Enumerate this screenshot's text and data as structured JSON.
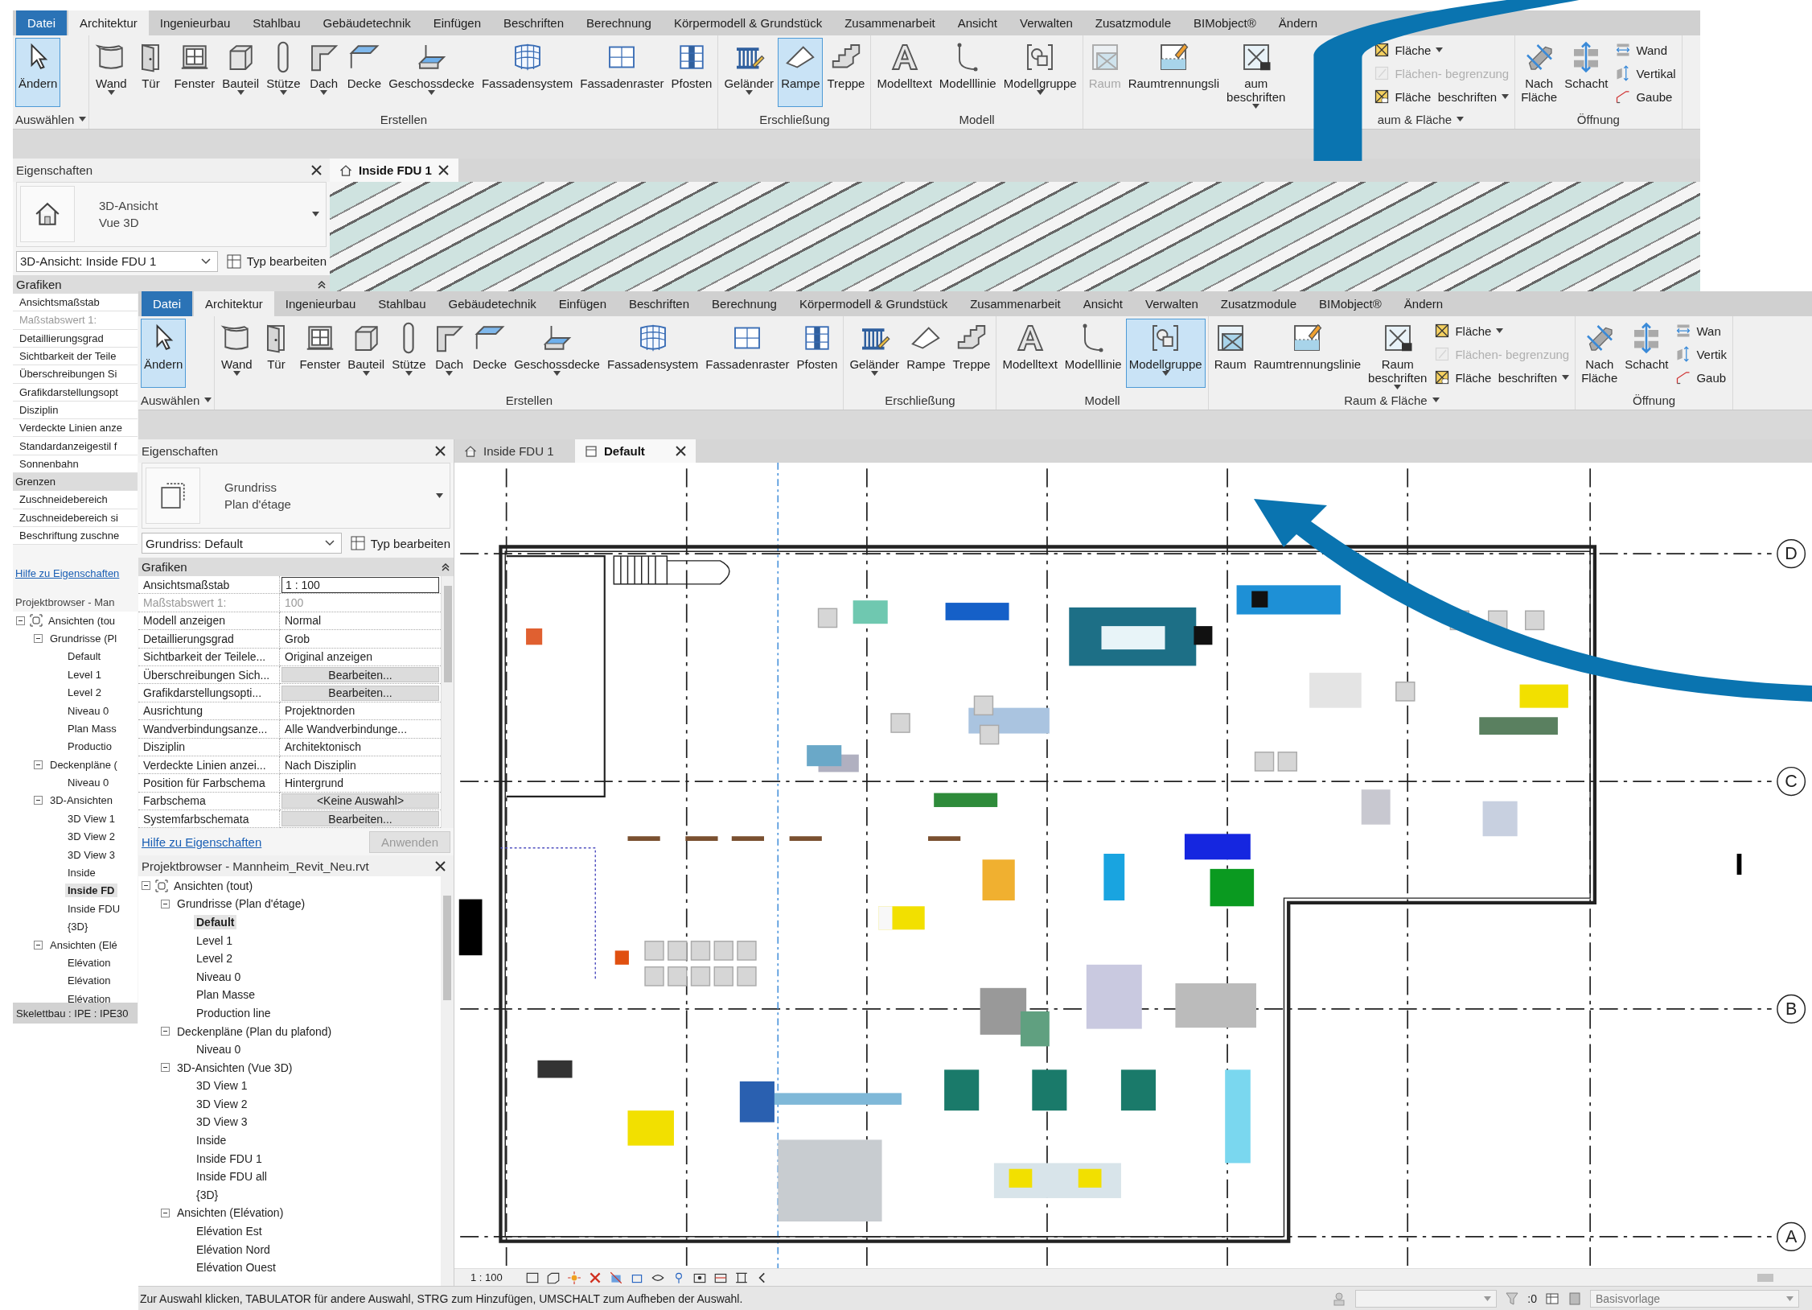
{
  "back_window": {
    "ribbon_tabs": [
      {
        "label": "Datei",
        "kind": "menu",
        "selected": false
      },
      {
        "label": "Architektur",
        "kind": "tab",
        "selected": true
      },
      {
        "label": "Ingenieurbau",
        "kind": "tab",
        "selected": false
      },
      {
        "label": "Stahlbau",
        "kind": "tab",
        "selected": false
      },
      {
        "label": "Gebäudetechnik",
        "kind": "tab",
        "selected": false
      },
      {
        "label": "Einfügen",
        "kind": "tab",
        "selected": false
      },
      {
        "label": "Beschriften",
        "kind": "tab",
        "selected": false
      },
      {
        "label": "Berechnung",
        "kind": "tab",
        "selected": false
      },
      {
        "label": "Körpermodell & Grundstück",
        "kind": "tab",
        "selected": false
      },
      {
        "label": "Zusammenarbeit",
        "kind": "tab",
        "selected": false
      },
      {
        "label": "Ansicht",
        "kind": "tab",
        "selected": false
      },
      {
        "label": "Verwalten",
        "kind": "tab",
        "selected": false
      },
      {
        "label": "Zusatzmodule",
        "kind": "tab",
        "selected": false
      },
      {
        "label": "BIMobject®",
        "kind": "tab",
        "selected": false
      },
      {
        "label": "Ändern",
        "kind": "tab",
        "selected": false
      }
    ],
    "ribbon_groups": [
      {
        "label": "Auswählen",
        "menu": true,
        "tools": [
          {
            "kind": "large",
            "label": "Ändern",
            "active": true,
            "disabled": false,
            "menu": false
          }
        ]
      },
      {
        "label": "Erstellen",
        "menu": false,
        "tools": [
          {
            "kind": "large",
            "label": "Wand",
            "active": false,
            "disabled": false,
            "menu": true
          },
          {
            "kind": "large",
            "label": "Tür",
            "active": false,
            "disabled": false,
            "menu": false
          },
          {
            "kind": "large",
            "label": "Fenster",
            "active": false,
            "disabled": false,
            "menu": false
          },
          {
            "kind": "large",
            "label": "Bauteil",
            "active": false,
            "disabled": false,
            "menu": true
          },
          {
            "kind": "large",
            "label": "Stütze",
            "active": false,
            "disabled": false,
            "menu": true
          },
          {
            "kind": "large",
            "label": "Dach",
            "active": false,
            "disabled": false,
            "menu": true
          },
          {
            "kind": "large",
            "label": "Decke",
            "active": false,
            "disabled": false,
            "menu": false
          },
          {
            "kind": "large",
            "label": "Geschossdecke",
            "active": false,
            "disabled": false,
            "menu": true
          },
          {
            "kind": "large",
            "label": "Fassadensystem",
            "active": false,
            "disabled": false,
            "menu": false
          },
          {
            "kind": "large",
            "label": "Fassadenraster",
            "active": false,
            "disabled": false,
            "menu": false
          },
          {
            "kind": "large",
            "label": "Pfosten",
            "active": false,
            "disabled": false,
            "menu": false
          }
        ]
      },
      {
        "label": "Erschließung",
        "menu": false,
        "tools": [
          {
            "kind": "large",
            "label": "Geländer",
            "active": false,
            "disabled": false,
            "menu": true
          },
          {
            "kind": "large",
            "label": "Rampe",
            "active": true,
            "disabled": false,
            "menu": false
          },
          {
            "kind": "large",
            "label": "Treppe",
            "active": false,
            "disabled": false,
            "menu": false
          }
        ]
      },
      {
        "label": "Modell",
        "menu": false,
        "tools": [
          {
            "kind": "large",
            "label": "Modelltext",
            "active": false,
            "disabled": false,
            "menu": false
          },
          {
            "kind": "large",
            "label": "Modelllinie",
            "active": false,
            "disabled": false,
            "menu": false
          },
          {
            "kind": "large",
            "label": "Modellgruppe",
            "active": false,
            "disabled": false,
            "menu": true
          }
        ]
      },
      {
        "label": "aum & Fläche",
        "menu": true,
        "tools": [
          {
            "kind": "large",
            "label": "Raum",
            "active": false,
            "disabled": true,
            "menu": false
          },
          {
            "kind": "large",
            "label": "Raumtrennungsli",
            "active": false,
            "disabled": false,
            "menu": false
          },
          {
            "kind": "large",
            "label": "aum\nbeschriften",
            "active": false,
            "disabled": false,
            "menu": true
          },
          {
            "kind": "stack",
            "items": [
              {
                "label": "Fläche",
                "disabled": false,
                "menu": true
              },
              {
                "label": "Flächen- begrenzung",
                "disabled": true,
                "menu": false
              },
              {
                "label": "Fläche  beschriften",
                "disabled": false,
                "menu": true
              }
            ]
          }
        ]
      },
      {
        "label": "Öffnung",
        "menu": false,
        "tools": [
          {
            "kind": "large",
            "label": "Nach\nFläche",
            "active": false,
            "disabled": false,
            "menu": false
          },
          {
            "kind": "large",
            "label": "Schacht",
            "active": false,
            "disabled": false,
            "menu": false
          },
          {
            "kind": "stack",
            "items": [
              {
                "label": "Wand",
                "disabled": false,
                "menu": false
              },
              {
                "label": "Vertikal",
                "disabled": false,
                "menu": false
              },
              {
                "label": "Gaube",
                "disabled": false,
                "menu": false
              }
            ]
          }
        ]
      }
    ],
    "properties": {
      "title": "Eigenschaften",
      "type_name": "3D-Ansicht",
      "type_sub": "Vue 3D",
      "selector": "3D-Ansicht: Inside FDU 1",
      "edit_type": "Typ bearbeiten",
      "section": "Grafiken",
      "rows": [
        {
          "label": "Ansichtsmaßstab",
          "kind": "row",
          "disabled": false
        },
        {
          "label": "Maßstabswert 1:",
          "kind": "row",
          "disabled": true
        },
        {
          "label": "Detaillierungsgrad",
          "kind": "row",
          "disabled": false
        },
        {
          "label": "Sichtbarkeit der Teile",
          "kind": "row",
          "disabled": false
        },
        {
          "label": "Überschreibungen Si",
          "kind": "row",
          "disabled": false
        },
        {
          "label": "Grafikdarstellungsopt",
          "kind": "row",
          "disabled": false
        },
        {
          "label": "Disziplin",
          "kind": "row",
          "disabled": false
        },
        {
          "label": "Verdeckte Linien anze",
          "kind": "row",
          "disabled": false
        },
        {
          "label": "Standardanzeigestil f",
          "kind": "row",
          "disabled": false
        },
        {
          "label": "Sonnenbahn",
          "kind": "row",
          "disabled": false
        },
        {
          "label": "Grenzen",
          "kind": "section",
          "disabled": false
        },
        {
          "label": "Zuschneidebereich",
          "kind": "row",
          "disabled": false
        },
        {
          "label": "Zuschneidebereich si",
          "kind": "row",
          "disabled": false
        },
        {
          "label": "Beschriftung zuschne",
          "kind": "row",
          "disabled": false
        }
      ],
      "help_link": "Hilfe zu Eigenschaften"
    },
    "browser": {
      "title": "Projektbrowser - Man",
      "tree": [
        {
          "label": "Ansichten (tou",
          "expanded": true,
          "selected": false,
          "children": [
            {
              "label": "Grundrisse (Pl",
              "expanded": true,
              "selected": false,
              "children": [
                {
                  "label": "Default",
                  "selected": false
                },
                {
                  "label": "Level 1",
                  "selected": false
                },
                {
                  "label": "Level 2",
                  "selected": false
                },
                {
                  "label": "Niveau 0",
                  "selected": false
                },
                {
                  "label": "Plan Mass",
                  "selected": false
                },
                {
                  "label": "Productio",
                  "selected": false
                }
              ]
            },
            {
              "label": "Deckenpläne (",
              "expanded": true,
              "selected": false,
              "children": [
                {
                  "label": "Niveau 0",
                  "selected": false
                }
              ]
            },
            {
              "label": "3D-Ansichten",
              "expanded": true,
              "selected": false,
              "children": [
                {
                  "label": "3D View 1",
                  "selected": false
                },
                {
                  "label": "3D View 2",
                  "selected": false
                },
                {
                  "label": "3D View 3",
                  "selected": false
                },
                {
                  "label": "Inside",
                  "selected": false
                },
                {
                  "label": "Inside FD",
                  "selected": true
                },
                {
                  "label": "Inside FDU",
                  "selected": false
                },
                {
                  "label": "{3D}",
                  "selected": false
                }
              ]
            },
            {
              "label": "Ansichten (Elé",
              "expanded": true,
              "selected": false,
              "children": [
                {
                  "label": "Elévation",
                  "selected": false
                },
                {
                  "label": "Elévation",
                  "selected": false
                },
                {
                  "label": "Elévation",
                  "selected": false
                }
              ]
            }
          ]
        }
      ]
    },
    "status": "Skelettbau : IPE : IPE30",
    "view_tab": "Inside FDU 1"
  },
  "front_window": {
    "ribbon_tabs": [
      {
        "label": "Datei",
        "kind": "menu",
        "selected": false
      },
      {
        "label": "Architektur",
        "kind": "tab",
        "selected": true
      },
      {
        "label": "Ingenieurbau",
        "kind": "tab",
        "selected": false
      },
      {
        "label": "Stahlbau",
        "kind": "tab",
        "selected": false
      },
      {
        "label": "Gebäudetechnik",
        "kind": "tab",
        "selected": false
      },
      {
        "label": "Einfügen",
        "kind": "tab",
        "selected": false
      },
      {
        "label": "Beschriften",
        "kind": "tab",
        "selected": false
      },
      {
        "label": "Berechnung",
        "kind": "tab",
        "selected": false
      },
      {
        "label": "Körpermodell & Grundstück",
        "kind": "tab",
        "selected": false
      },
      {
        "label": "Zusammenarbeit",
        "kind": "tab",
        "selected": false
      },
      {
        "label": "Ansicht",
        "kind": "tab",
        "selected": false
      },
      {
        "label": "Verwalten",
        "kind": "tab",
        "selected": false
      },
      {
        "label": "Zusatzmodule",
        "kind": "tab",
        "selected": false
      },
      {
        "label": "BIMobject®",
        "kind": "tab",
        "selected": false
      },
      {
        "label": "Ändern",
        "kind": "tab",
        "selected": false
      }
    ],
    "ribbon_groups": [
      {
        "label": "Auswählen",
        "menu": true,
        "tools": [
          {
            "kind": "large",
            "label": "Ändern",
            "active": true,
            "disabled": false,
            "menu": false
          }
        ]
      },
      {
        "label": "Erstellen",
        "menu": false,
        "tools": [
          {
            "kind": "large",
            "label": "Wand",
            "active": false,
            "disabled": false,
            "menu": true
          },
          {
            "kind": "large",
            "label": "Tür",
            "active": false,
            "disabled": false,
            "menu": false
          },
          {
            "kind": "large",
            "label": "Fenster",
            "active": false,
            "disabled": false,
            "menu": false
          },
          {
            "kind": "large",
            "label": "Bauteil",
            "active": false,
            "disabled": false,
            "menu": true
          },
          {
            "kind": "large",
            "label": "Stütze",
            "active": false,
            "disabled": false,
            "menu": true
          },
          {
            "kind": "large",
            "label": "Dach",
            "active": false,
            "disabled": false,
            "menu": true
          },
          {
            "kind": "large",
            "label": "Decke",
            "active": false,
            "disabled": false,
            "menu": false
          },
          {
            "kind": "large",
            "label": "Geschossdecke",
            "active": false,
            "disabled": false,
            "menu": true
          },
          {
            "kind": "large",
            "label": "Fassadensystem",
            "active": false,
            "disabled": false,
            "menu": false
          },
          {
            "kind": "large",
            "label": "Fassadenraster",
            "active": false,
            "disabled": false,
            "menu": false
          },
          {
            "kind": "large",
            "label": "Pfosten",
            "active": false,
            "disabled": false,
            "menu": false
          }
        ]
      },
      {
        "label": "Erschließung",
        "menu": false,
        "tools": [
          {
            "kind": "large",
            "label": "Geländer",
            "active": false,
            "disabled": false,
            "menu": true
          },
          {
            "kind": "large",
            "label": "Rampe",
            "active": false,
            "disabled": false,
            "menu": false
          },
          {
            "kind": "large",
            "label": "Treppe",
            "active": false,
            "disabled": false,
            "menu": false
          }
        ]
      },
      {
        "label": "Modell",
        "menu": false,
        "tools": [
          {
            "kind": "large",
            "label": "Modelltext",
            "active": false,
            "disabled": false,
            "menu": false
          },
          {
            "kind": "large",
            "label": "Modelllinie",
            "active": false,
            "disabled": false,
            "menu": false
          },
          {
            "kind": "large",
            "label": "Modellgruppe",
            "active": true,
            "disabled": false,
            "menu": true
          }
        ]
      },
      {
        "label": "Raum & Fläche",
        "menu": true,
        "tools": [
          {
            "kind": "large",
            "label": "Raum",
            "active": false,
            "disabled": false,
            "menu": false
          },
          {
            "kind": "large",
            "label": "Raumtrennungslinie",
            "active": false,
            "disabled": false,
            "menu": false
          },
          {
            "kind": "large",
            "label": "Raum\nbeschriften",
            "active": false,
            "disabled": false,
            "menu": true
          },
          {
            "kind": "stack",
            "items": [
              {
                "label": "Fläche",
                "disabled": false,
                "menu": true
              },
              {
                "label": "Flächen- begrenzung",
                "disabled": true,
                "menu": false
              },
              {
                "label": "Fläche  beschriften",
                "disabled": false,
                "menu": true
              }
            ]
          }
        ]
      },
      {
        "label": "Öffnung",
        "menu": false,
        "tools": [
          {
            "kind": "large",
            "label": "Nach\nFläche",
            "active": false,
            "disabled": false,
            "menu": false
          },
          {
            "kind": "large",
            "label": "Schacht",
            "active": false,
            "disabled": false,
            "menu": false
          },
          {
            "kind": "stack",
            "items": [
              {
                "label": "Wan",
                "disabled": false,
                "menu": false
              },
              {
                "label": "Vertik",
                "disabled": false,
                "menu": false
              },
              {
                "label": "Gaub",
                "disabled": false,
                "menu": false
              }
            ]
          }
        ]
      }
    ],
    "properties": {
      "title": "Eigenschaften",
      "type_name": "Grundriss",
      "type_sub": "Plan d'étage",
      "selector": "Grundriss: Default",
      "edit_type": "Typ bearbeiten",
      "section": "Grafiken",
      "rows": [
        {
          "label": "Ansichtsmaßstab",
          "value": "1 : 100",
          "kind": "input"
        },
        {
          "label": "Maßstabswert 1:",
          "value": "100",
          "kind": "readonly"
        },
        {
          "label": "Modell anzeigen",
          "value": "Normal",
          "kind": "text"
        },
        {
          "label": "Detaillierungsgrad",
          "value": "Grob",
          "kind": "text"
        },
        {
          "label": "Sichtbarkeit der Teilele...",
          "value": "Original anzeigen",
          "kind": "text"
        },
        {
          "label": "Überschreibungen Sich...",
          "value": "Bearbeiten...",
          "kind": "button"
        },
        {
          "label": "Grafikdarstellungsopti...",
          "value": "Bearbeiten...",
          "kind": "button"
        },
        {
          "label": "Ausrichtung",
          "value": "Projektnorden",
          "kind": "text"
        },
        {
          "label": "Wandverbindungsanze...",
          "value": "Alle Wandverbindunge...",
          "kind": "text"
        },
        {
          "label": "Disziplin",
          "value": "Architektonisch",
          "kind": "text"
        },
        {
          "label": "Verdeckte Linien anzei...",
          "value": "Nach Disziplin",
          "kind": "text"
        },
        {
          "label": "Position für Farbschema",
          "value": "Hintergrund",
          "kind": "text"
        },
        {
          "label": "Farbschema",
          "value": "<Keine Auswahl>",
          "kind": "button"
        },
        {
          "label": "Systemfarbschemata",
          "value": "Bearbeiten...",
          "kind": "button"
        }
      ],
      "help_link": "Hilfe zu Eigenschaften",
      "apply": "Anwenden"
    },
    "browser": {
      "title": "Projektbrowser - Mannheim_Revit_Neu.rvt",
      "tree": [
        {
          "label": "Ansichten (tout)",
          "expanded": true,
          "selected": false,
          "children": [
            {
              "label": "Grundrisse (Plan d'étage)",
              "expanded": true,
              "selected": false,
              "children": [
                {
                  "label": "Default",
                  "selected": true
                },
                {
                  "label": "Level 1",
                  "selected": false
                },
                {
                  "label": "Level 2",
                  "selected": false
                },
                {
                  "label": "Niveau 0",
                  "selected": false
                },
                {
                  "label": "Plan Masse",
                  "selected": false
                },
                {
                  "label": "Production line",
                  "selected": false
                }
              ]
            },
            {
              "label": "Deckenpläne (Plan du plafond)",
              "expanded": true,
              "selected": false,
              "children": [
                {
                  "label": "Niveau 0",
                  "selected": false
                }
              ]
            },
            {
              "label": "3D-Ansichten (Vue 3D)",
              "expanded": true,
              "selected": false,
              "children": [
                {
                  "label": "3D View 1",
                  "selected": false
                },
                {
                  "label": "3D View 2",
                  "selected": false
                },
                {
                  "label": "3D View 3",
                  "selected": false
                },
                {
                  "label": "Inside",
                  "selected": false
                },
                {
                  "label": "Inside FDU 1",
                  "selected": false
                },
                {
                  "label": "Inside FDU all",
                  "selected": false
                },
                {
                  "label": "{3D}",
                  "selected": false
                }
              ]
            },
            {
              "label": "Ansichten (Elévation)",
              "expanded": true,
              "selected": false,
              "children": [
                {
                  "label": "Elévation Est",
                  "selected": false
                },
                {
                  "label": "Elévation Nord",
                  "selected": false
                },
                {
                  "label": "Elévation Ouest",
                  "selected": false
                }
              ]
            }
          ]
        }
      ]
    },
    "view_tabs": [
      {
        "label": "Inside FDU 1",
        "selected": false
      },
      {
        "label": "Default",
        "selected": true
      }
    ],
    "plan": {
      "grid_labels": [
        "D",
        "C",
        "B",
        "A"
      ]
    },
    "view_bar": {
      "scale": "1 : 100"
    },
    "status_bar": {
      "message": "Zur Auswahl klicken, TABULATOR für andere Auswahl, STRG zum Hinzufügen, UMSCHALT zum Aufheben der Auswahl.",
      "filter_count": ":0",
      "template": "Basisvorlage"
    }
  }
}
